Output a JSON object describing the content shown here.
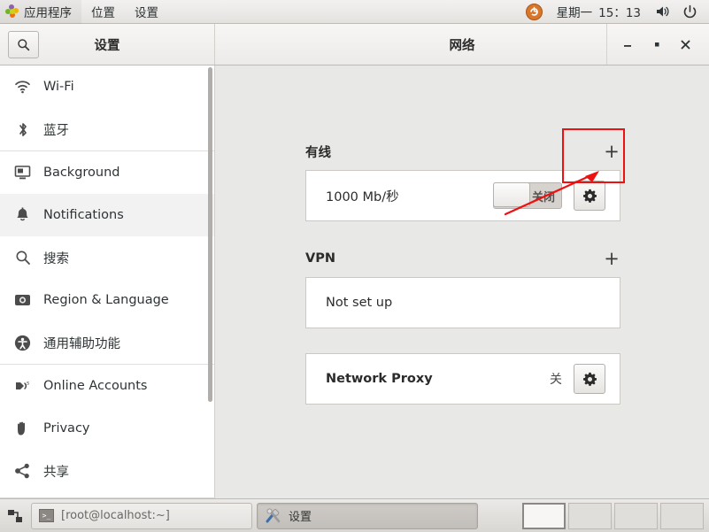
{
  "panel": {
    "apps_label": "应用程序",
    "places_label": "位置",
    "settings_label": "设置",
    "day_label": "星期一",
    "clock": "15：13",
    "apps_icon": "applications-pinwheel-icon",
    "volume_icon": "speaker-icon",
    "power_icon": "power-icon",
    "indicator_icon": "update-indicator-icon"
  },
  "sidebar": {
    "title": "设置",
    "search_icon": "search-icon",
    "items": [
      {
        "label": "Wi-Fi",
        "icon": "wifi-icon",
        "selected": false,
        "sep_after": false
      },
      {
        "label": "蓝牙",
        "icon": "bluetooth-icon",
        "selected": false,
        "sep_after": true
      },
      {
        "label": "Background",
        "icon": "background-icon",
        "selected": false,
        "sep_after": false
      },
      {
        "label": "Notifications",
        "icon": "bell-icon",
        "selected": true,
        "sep_after": false
      },
      {
        "label": "搜索",
        "icon": "search-icon",
        "selected": false,
        "sep_after": false
      },
      {
        "label": "Region & Language",
        "icon": "region-icon",
        "selected": false,
        "sep_after": false
      },
      {
        "label": "通用辅助功能",
        "icon": "accessibility-icon",
        "selected": false,
        "sep_after": true
      },
      {
        "label": "Online Accounts",
        "icon": "online-accounts-icon",
        "selected": false,
        "sep_after": false
      },
      {
        "label": "Privacy",
        "icon": "hand-privacy-icon",
        "selected": false,
        "sep_after": false
      },
      {
        "label": "共享",
        "icon": "share-icon",
        "selected": false,
        "sep_after": false
      }
    ]
  },
  "window": {
    "title": "网络",
    "minimize_icon": "minimize-icon",
    "maximize_icon": "maximize-icon",
    "close_icon": "close-icon"
  },
  "network": {
    "wired": {
      "title": "有线",
      "add_label": "+",
      "speed": "1000 Mb/秒",
      "toggle_state_label": "关闭",
      "toggle_on": false,
      "settings_icon": "gear-icon"
    },
    "vpn": {
      "title": "VPN",
      "add_label": "+",
      "empty_label": "Not set up"
    },
    "proxy": {
      "label": "Network Proxy",
      "status": "关",
      "settings_icon": "gear-icon"
    }
  },
  "annotation": {
    "color": "#ee1111",
    "target": "wired-settings-gear-button"
  },
  "taskbar": {
    "show_desktop_icon": "show-desktop-icon",
    "windows": [
      {
        "label": "[root@localhost:~]",
        "icon": "terminal-icon",
        "active": false
      },
      {
        "label": "设置",
        "icon": "settings-tools-icon",
        "active": true
      }
    ],
    "workspaces": [
      {
        "name": "workspace-1",
        "active": true
      },
      {
        "name": "workspace-2",
        "active": false
      },
      {
        "name": "workspace-3",
        "active": false
      },
      {
        "name": "workspace-4",
        "active": false
      }
    ]
  }
}
